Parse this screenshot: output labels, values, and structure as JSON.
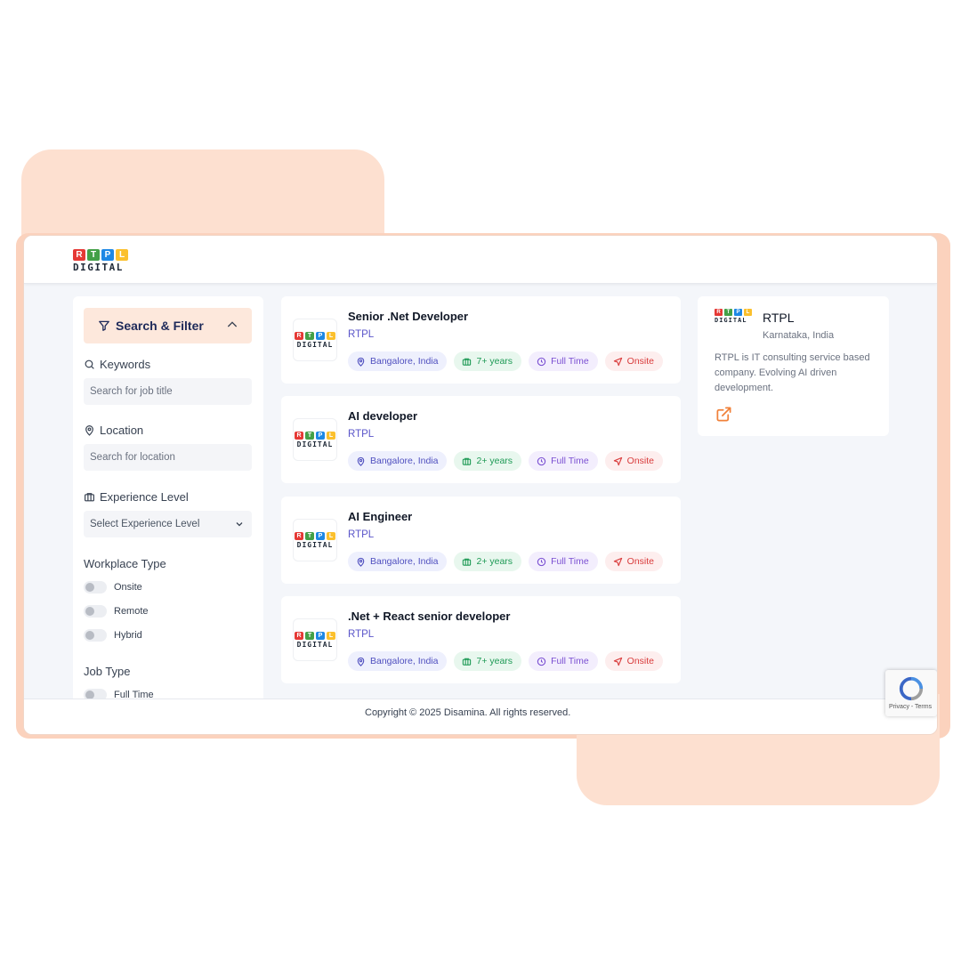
{
  "brand": {
    "logo_letters": [
      "R",
      "T",
      "P",
      "L"
    ],
    "logo_colors": [
      "#e53935",
      "#43a047",
      "#1e88e5",
      "#fbc02d"
    ],
    "logo_word": "DIGITAL"
  },
  "sidebar": {
    "title": "Search & Filter",
    "keywords": {
      "label": "Keywords",
      "placeholder": "Search for job title"
    },
    "location": {
      "label": "Location",
      "placeholder": "Search for location"
    },
    "experience": {
      "label": "Experience Level",
      "selected": "Select Experience Level"
    },
    "workplace": {
      "label": "Workplace Type",
      "options": [
        "Onsite",
        "Remote",
        "Hybrid"
      ]
    },
    "job_type": {
      "label": "Job Type",
      "options": [
        "Full Time"
      ]
    }
  },
  "jobs": [
    {
      "title": "Senior .Net Developer",
      "company": "RTPL",
      "location": "Bangalore, India",
      "experience": "7+ years",
      "type": "Full Time",
      "mode": "Onsite"
    },
    {
      "title": "AI developer",
      "company": "RTPL",
      "location": "Bangalore, India",
      "experience": "2+ years",
      "type": "Full Time",
      "mode": "Onsite"
    },
    {
      "title": "AI Engineer",
      "company": "RTPL",
      "location": "Bangalore, India",
      "experience": "2+ years",
      "type": "Full Time",
      "mode": "Onsite"
    },
    {
      "title": ".Net + React senior developer",
      "company": "RTPL",
      "location": "Bangalore, India",
      "experience": "7+ years",
      "type": "Full Time",
      "mode": "Onsite"
    }
  ],
  "company": {
    "name": "RTPL",
    "location": "Karnataka, India",
    "description": "RTPL is IT consulting service based company. Evolving AI driven development."
  },
  "footer": {
    "copyright": "Copyright © 2025 Disamina. All rights reserved."
  },
  "recaptcha": {
    "terms": "Privacy - Terms"
  },
  "colors": {
    "accent_peach": "#fde0d0",
    "filter_bg": "#fde8dc",
    "link_orange": "#f0813a"
  }
}
